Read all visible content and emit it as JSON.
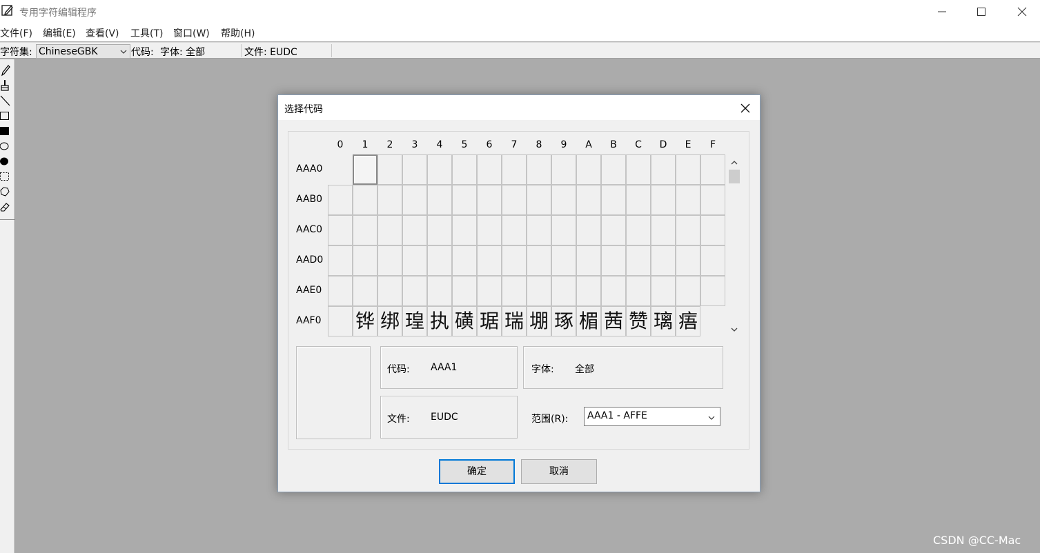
{
  "window": {
    "title": "专用字符编辑程序",
    "icons": {
      "app": "edit-icon",
      "minimize": "minimize-icon",
      "maximize": "maximize-icon",
      "close": "close-icon"
    }
  },
  "menu": [
    "文件(F)",
    "编辑(E)",
    "查看(V)",
    "工具(T)",
    "窗口(W)",
    "帮助(H)"
  ],
  "statusbar": {
    "charset_label": "字符集:",
    "charset_value": "ChineseGBK",
    "code_label": "代码:",
    "font_text": "字体: 全部",
    "file_text": "文件: EUDC"
  },
  "tools": [
    "pencil-icon",
    "brush-icon",
    "line-icon",
    "hollow-rectangle-icon",
    "filled-rectangle-icon",
    "hollow-ellipse-icon",
    "filled-ellipse-icon",
    "rectangular-selection-icon",
    "freeform-selection-icon",
    "eraser-icon"
  ],
  "dialog": {
    "title": "选择代码",
    "columns": [
      "0",
      "1",
      "2",
      "3",
      "4",
      "5",
      "6",
      "7",
      "8",
      "9",
      "A",
      "B",
      "C",
      "D",
      "E",
      "F"
    ],
    "rows": [
      {
        "label": "AAA0",
        "cells": [
          "",
          "",
          "",
          "",
          "",
          "",
          "",
          "",
          "",
          "",
          "",
          "",
          "",
          "",
          "",
          ""
        ]
      },
      {
        "label": "AAB0",
        "cells": [
          "",
          "",
          "",
          "",
          "",
          "",
          "",
          "",
          "",
          "",
          "",
          "",
          "",
          "",
          "",
          ""
        ]
      },
      {
        "label": "AAC0",
        "cells": [
          "",
          "",
          "",
          "",
          "",
          "",
          "",
          "",
          "",
          "",
          "",
          "",
          "",
          "",
          "",
          ""
        ]
      },
      {
        "label": "AAD0",
        "cells": [
          "",
          "",
          "",
          "",
          "",
          "",
          "",
          "",
          "",
          "",
          "",
          "",
          "",
          "",
          "",
          ""
        ]
      },
      {
        "label": "AAE0",
        "cells": [
          "",
          "",
          "",
          "",
          "",
          "",
          "",
          "",
          "",
          "",
          "",
          "",
          "",
          "",
          "",
          ""
        ]
      },
      {
        "label": "AAF0",
        "cells": [
          "",
          "铧",
          "绑",
          "瑝",
          "执",
          "磺",
          "琚",
          "瑞",
          "堋",
          "琢",
          "楣",
          "茜",
          "赞",
          "璃",
          "痦",
          ""
        ]
      }
    ],
    "selected_code": "AAA1",
    "code_label": "代码:",
    "code_value": "AAA1",
    "font_label": "字体:",
    "font_value": "全部",
    "file_label": "文件:",
    "file_value": "EUDC",
    "range_label": "范围(R):",
    "range_value": "AAA1 - AFFE",
    "ok_label": "确定",
    "cancel_label": "取消"
  },
  "watermark": "CSDN @CC-Mac"
}
